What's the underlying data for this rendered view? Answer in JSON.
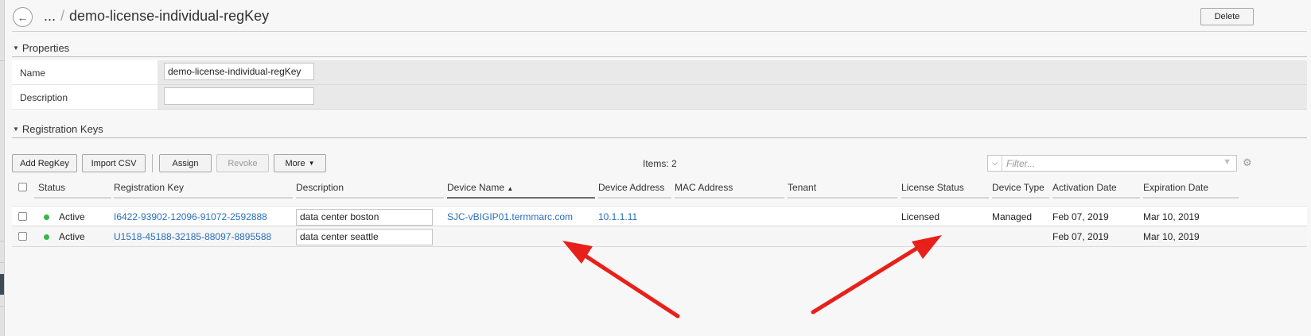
{
  "breadcrumb": {
    "ellipsis": "...",
    "separator": "/",
    "current": "demo-license-individual-regKey"
  },
  "actions": {
    "delete_label": "Delete"
  },
  "properties": {
    "title": "Properties",
    "name_label": "Name",
    "name_value": "demo-license-individual-regKey",
    "description_label": "Description",
    "description_value": ""
  },
  "registration_keys": {
    "title": "Registration Keys",
    "toolbar": {
      "add": "Add RegKey",
      "import": "Import CSV",
      "assign": "Assign",
      "revoke": "Revoke",
      "more": "More"
    },
    "items_count": "Items: 2",
    "filter_placeholder": "Filter...",
    "columns": [
      "Status",
      "Registration Key",
      "Description",
      "Device Name",
      "Device Address",
      "MAC Address",
      "Tenant",
      "License Status",
      "Device Type",
      "Activation Date",
      "Expiration Date"
    ],
    "sorted_column": "Device Name",
    "rows": [
      {
        "status": "Active",
        "registration_key": "I6422-93902-12096-91072-2592888",
        "description": "data center boston",
        "device_name": "SJC-vBIGIP01.termmarc.com",
        "device_address": "10.1.1.11",
        "mac_address": "",
        "tenant": "",
        "license_status": "Licensed",
        "device_type": "Managed",
        "activation_date": "Feb 07, 2019",
        "expiration_date": "Mar 10, 2019"
      },
      {
        "status": "Active",
        "registration_key": "U1518-45188-32185-88097-8895588",
        "description": "data center seattle",
        "device_name": "",
        "device_address": "",
        "mac_address": "",
        "tenant": "",
        "license_status": "",
        "device_type": "",
        "activation_date": "Feb 07, 2019",
        "expiration_date": "Mar 10, 2019"
      }
    ]
  },
  "colors": {
    "link": "#2a6ebb",
    "status_active": "#39b54a",
    "annotation_arrow": "#e8201a"
  },
  "icons": {
    "back": "back-arrow-icon",
    "collapse": "triangle-down-icon",
    "sort": "sort-ascending-icon",
    "filter": "funnel-icon",
    "settings": "gear-icon"
  }
}
